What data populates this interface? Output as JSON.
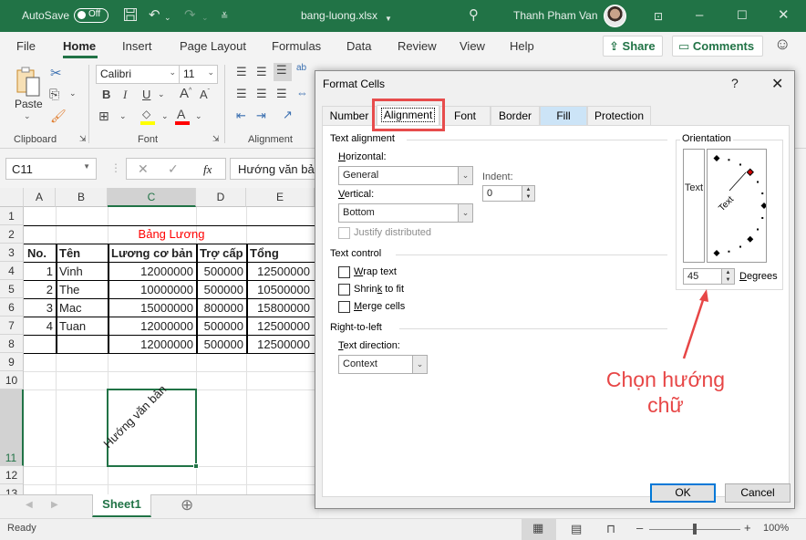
{
  "titlebar": {
    "autosave_label": "AutoSave",
    "autosave_state": "Off",
    "filename": "bang-luong.xlsx",
    "user_name": "Thanh Pham Van",
    "icons": [
      "save-icon",
      "undo-icon",
      "redo-icon",
      "customize-qat-icon",
      "search-icon",
      "ribbon-display-icon",
      "minimize-icon",
      "maximize-icon",
      "close-icon"
    ]
  },
  "menu": {
    "items": [
      "File",
      "Home",
      "Insert",
      "Page Layout",
      "Formulas",
      "Data",
      "Review",
      "View",
      "Help"
    ],
    "active": "Home",
    "share_label": "Share",
    "comments_label": "Comments"
  },
  "ribbon": {
    "clipboard": {
      "paste_label": "Paste",
      "group_label": "Clipboard"
    },
    "font": {
      "font_name": "Calibri",
      "font_size": "11",
      "group_label": "Font",
      "fill_color": "#ffff00",
      "font_color": "#ff0000"
    },
    "alignment": {
      "group_label": "Alignment"
    }
  },
  "formula_bar": {
    "name_box": "C11",
    "fx_label": "fx",
    "formula": "Hướng văn bản"
  },
  "sheet": {
    "columns": [
      "A",
      "B",
      "C",
      "D",
      "E"
    ],
    "selected_column": "C",
    "rows": [
      "1",
      "2",
      "3",
      "4",
      "5",
      "6",
      "7",
      "8",
      "9",
      "10",
      "11",
      "12",
      "13"
    ],
    "selected_row": "11",
    "title": "Bảng Lương",
    "title_color": "#ff0000",
    "headers": [
      "No.",
      "Tên",
      "Lương cơ bản",
      "Trợ cấp",
      "Tổng"
    ],
    "data": [
      [
        "1",
        "Vinh",
        "12000000",
        "500000",
        "12500000"
      ],
      [
        "2",
        "The",
        "10000000",
        "500000",
        "10500000"
      ],
      [
        "3",
        "Mac",
        "15000000",
        "800000",
        "15800000"
      ],
      [
        "4",
        "Tuan",
        "12000000",
        "500000",
        "12500000"
      ],
      [
        "",
        "",
        "12000000",
        "500000",
        "12500000"
      ]
    ],
    "rotated_cell_text": "Hướng văn bản",
    "rotated_degrees": 45
  },
  "sheet_tabs": {
    "active": "Sheet1"
  },
  "status": {
    "text": "Ready",
    "zoom": "100%",
    "zoom_fraction": 0.5
  },
  "dialog": {
    "title": "Format Cells",
    "help": "?",
    "tabs": [
      "Number",
      "Alignment",
      "Font",
      "Border",
      "Fill",
      "Protection"
    ],
    "active_tab": "Alignment",
    "text_alignment": {
      "section": "Text alignment",
      "horizontal_label": "Horizontal:",
      "horizontal_value": "General",
      "vertical_label": "Vertical:",
      "vertical_value": "Bottom",
      "indent_label": "Indent:",
      "indent_value": "0",
      "justify_distributed": "Justify distributed"
    },
    "text_control": {
      "section": "Text control",
      "wrap": "Wrap text",
      "shrink": "Shrink to fit",
      "merge": "Merge cells"
    },
    "rtl": {
      "section": "Right-to-left",
      "direction_label": "Text direction:",
      "direction_value": "Context"
    },
    "orientation": {
      "section": "Orientation",
      "vertical_text": "Text",
      "dial_text": "Text",
      "degrees_value": "45",
      "degrees_label": "Degrees"
    },
    "ok": "OK",
    "cancel": "Cancel"
  },
  "annotation": {
    "text": "Chọn hướng chữ",
    "color": "#e74646"
  }
}
